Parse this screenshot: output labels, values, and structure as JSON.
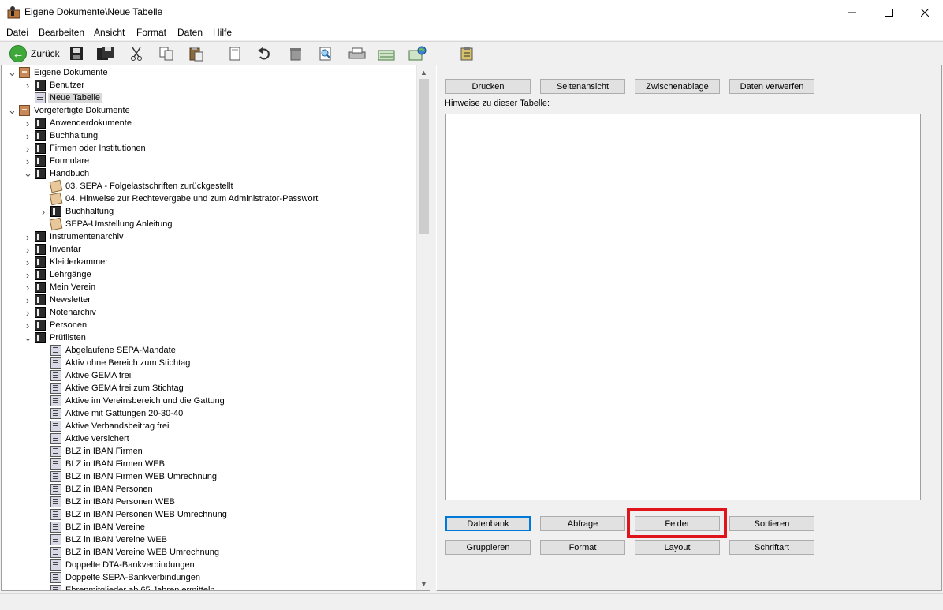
{
  "window": {
    "title": "Eigene Dokumente\\Neue Tabelle",
    "min": "—",
    "max": "☐",
    "close": "✕"
  },
  "menu": [
    "Datei",
    "Bearbeiten",
    "Ansicht",
    "Format",
    "Daten",
    "Hilfe"
  ],
  "toolbar": {
    "back_label": "Zurück",
    "icons": [
      "save-icon",
      "save-all-icon",
      "cut-icon",
      "copy-icon",
      "paste-icon",
      "new-page-icon",
      "undo-icon",
      "delete-icon",
      "preview-icon",
      "print-icon",
      "export-icon",
      "web-export-icon",
      "tools-icon"
    ]
  },
  "tree": {
    "items": [
      {
        "label": "Eigene Dokumente",
        "level": 0,
        "toggle": "v",
        "icon": "cabinet"
      },
      {
        "label": "Benutzer",
        "level": 1,
        "toggle": ">",
        "icon": "book"
      },
      {
        "label": "Neue Tabelle",
        "level": 1,
        "toggle": "",
        "icon": "page",
        "selected": true
      },
      {
        "label": "Vorgefertigte Dokumente",
        "level": 0,
        "toggle": "v",
        "icon": "cabinet"
      },
      {
        "label": "Anwenderdokumente",
        "level": 1,
        "toggle": ">",
        "icon": "book"
      },
      {
        "label": "Buchhaltung",
        "level": 1,
        "toggle": ">",
        "icon": "book"
      },
      {
        "label": "Firmen oder Institutionen",
        "level": 1,
        "toggle": ">",
        "icon": "book"
      },
      {
        "label": "Formulare",
        "level": 1,
        "toggle": ">",
        "icon": "book"
      },
      {
        "label": "Handbuch",
        "level": 1,
        "toggle": "v",
        "icon": "book"
      },
      {
        "label": "03. SEPA - Folgelastschriften zurückgestellt",
        "level": 2,
        "toggle": "",
        "icon": "note"
      },
      {
        "label": "04. Hinweise zur Rechtevergabe und zum Administrator-Passwort",
        "level": 2,
        "toggle": "",
        "icon": "note"
      },
      {
        "label": "Buchhaltung",
        "level": 2,
        "toggle": ">",
        "icon": "book"
      },
      {
        "label": "SEPA-Umstellung Anleitung",
        "level": 2,
        "toggle": "",
        "icon": "note"
      },
      {
        "label": "Instrumentenarchiv",
        "level": 1,
        "toggle": ">",
        "icon": "book"
      },
      {
        "label": "Inventar",
        "level": 1,
        "toggle": ">",
        "icon": "book"
      },
      {
        "label": "Kleiderkammer",
        "level": 1,
        "toggle": ">",
        "icon": "book"
      },
      {
        "label": "Lehrgänge",
        "level": 1,
        "toggle": ">",
        "icon": "book"
      },
      {
        "label": "Mein Verein",
        "level": 1,
        "toggle": ">",
        "icon": "book"
      },
      {
        "label": "Newsletter",
        "level": 1,
        "toggle": ">",
        "icon": "book"
      },
      {
        "label": "Notenarchiv",
        "level": 1,
        "toggle": ">",
        "icon": "book"
      },
      {
        "label": "Personen",
        "level": 1,
        "toggle": ">",
        "icon": "book"
      },
      {
        "label": "Prüflisten",
        "level": 1,
        "toggle": "v",
        "icon": "book"
      },
      {
        "label": "Abgelaufene SEPA-Mandate",
        "level": 2,
        "toggle": "",
        "icon": "page"
      },
      {
        "label": "Aktiv ohne Bereich zum Stichtag",
        "level": 2,
        "toggle": "",
        "icon": "page"
      },
      {
        "label": "Aktive GEMA frei",
        "level": 2,
        "toggle": "",
        "icon": "page"
      },
      {
        "label": "Aktive GEMA frei zum Stichtag",
        "level": 2,
        "toggle": "",
        "icon": "page"
      },
      {
        "label": "Aktive im Vereinsbereich und die Gattung",
        "level": 2,
        "toggle": "",
        "icon": "page"
      },
      {
        "label": "Aktive mit Gattungen 20-30-40",
        "level": 2,
        "toggle": "",
        "icon": "page"
      },
      {
        "label": "Aktive Verbandsbeitrag frei",
        "level": 2,
        "toggle": "",
        "icon": "page"
      },
      {
        "label": "Aktive versichert",
        "level": 2,
        "toggle": "",
        "icon": "page"
      },
      {
        "label": "BLZ in IBAN Firmen",
        "level": 2,
        "toggle": "",
        "icon": "page"
      },
      {
        "label": "BLZ in IBAN Firmen WEB",
        "level": 2,
        "toggle": "",
        "icon": "page"
      },
      {
        "label": "BLZ in IBAN Firmen WEB Umrechnung",
        "level": 2,
        "toggle": "",
        "icon": "page"
      },
      {
        "label": "BLZ in IBAN Personen",
        "level": 2,
        "toggle": "",
        "icon": "page"
      },
      {
        "label": "BLZ in IBAN Personen WEB",
        "level": 2,
        "toggle": "",
        "icon": "page"
      },
      {
        "label": "BLZ in IBAN Personen WEB Umrechnung",
        "level": 2,
        "toggle": "",
        "icon": "page"
      },
      {
        "label": "BLZ in IBAN Vereine",
        "level": 2,
        "toggle": "",
        "icon": "page"
      },
      {
        "label": "BLZ in IBAN Vereine WEB",
        "level": 2,
        "toggle": "",
        "icon": "page"
      },
      {
        "label": "BLZ in IBAN Vereine WEB Umrechnung",
        "level": 2,
        "toggle": "",
        "icon": "page"
      },
      {
        "label": "Doppelte DTA-Bankverbindungen",
        "level": 2,
        "toggle": "",
        "icon": "page"
      },
      {
        "label": "Doppelte SEPA-Bankverbindungen",
        "level": 2,
        "toggle": "",
        "icon": "page"
      },
      {
        "label": "Ehrenmitglieder ab 65 Jahren ermitteln",
        "level": 2,
        "toggle": "",
        "icon": "page"
      }
    ]
  },
  "top_buttons": [
    "Drucken",
    "Seitenansicht",
    "Zwischenablage",
    "Daten verwerfen"
  ],
  "hint_label": "Hinweise zu dieser Tabelle:",
  "bottom_buttons": [
    "Datenbank",
    "Abfrage",
    "Felder",
    "Sortieren",
    "Gruppieren",
    "Format",
    "Layout",
    "Schriftart"
  ],
  "colors": {
    "highlight": "#e0141b",
    "selection": "#d9d9d9",
    "default_button_border": "#0078d7"
  }
}
